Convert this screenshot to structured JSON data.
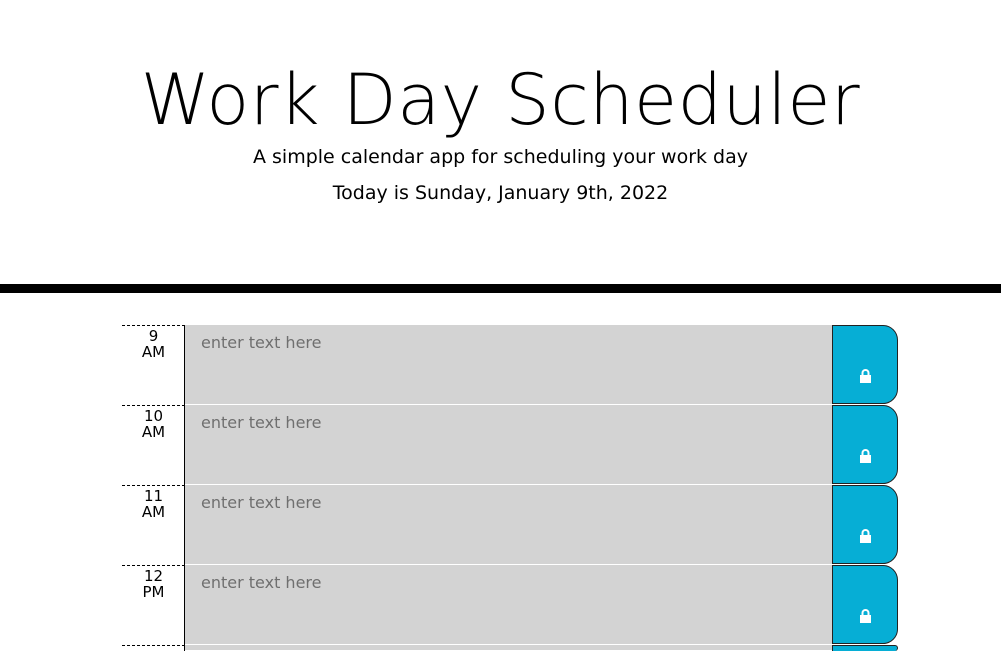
{
  "header": {
    "title": "Work Day Scheduler",
    "subtitle": "A simple calendar app for scheduling your work day",
    "today": "Today is Sunday, January 9th, 2022"
  },
  "colors": {
    "past": "#d3d3d3",
    "save_button": "#06aed5",
    "divider": "#000000"
  },
  "time_blocks": [
    {
      "hour": "9",
      "meridiem": "AM",
      "placeholder": "enter text here",
      "value": "",
      "save_icon": "lock-icon"
    },
    {
      "hour": "10",
      "meridiem": "AM",
      "placeholder": "enter text here",
      "value": "",
      "save_icon": "lock-icon"
    },
    {
      "hour": "11",
      "meridiem": "AM",
      "placeholder": "enter text here",
      "value": "",
      "save_icon": "lock-icon"
    },
    {
      "hour": "12",
      "meridiem": "PM",
      "placeholder": "enter text here",
      "value": "",
      "save_icon": "lock-icon"
    }
  ]
}
